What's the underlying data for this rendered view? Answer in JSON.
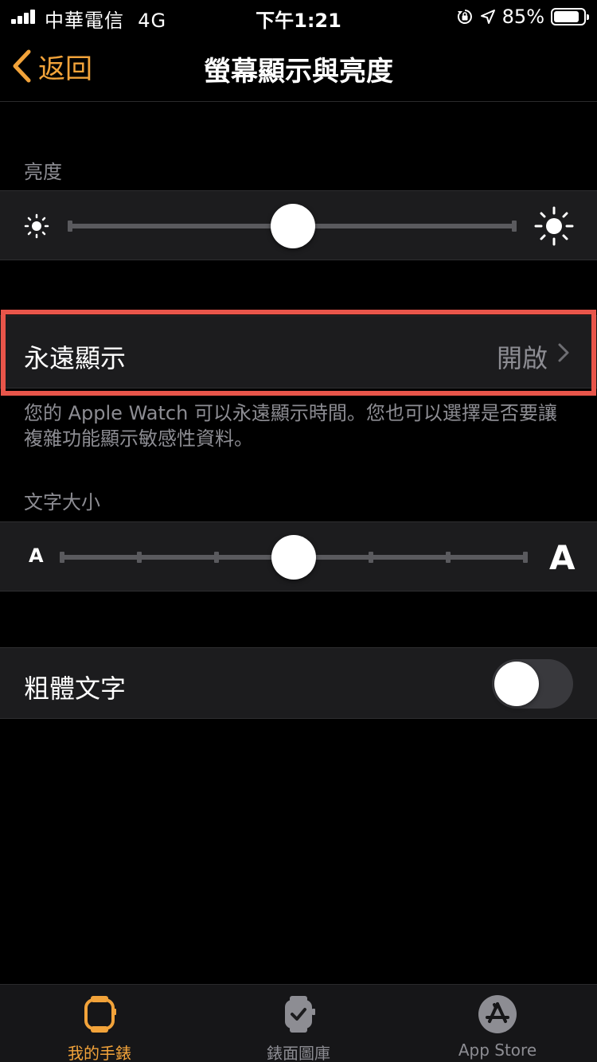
{
  "status_bar": {
    "carrier": "中華電信",
    "network": "4G",
    "time": "下午1:21",
    "battery_percent": "85%",
    "battery_level": 0.85
  },
  "nav": {
    "back_label": "返回",
    "title": "螢幕顯示與亮度"
  },
  "brightness": {
    "header": "亮度",
    "level": 0.5
  },
  "always_on": {
    "label": "永遠顯示",
    "value": "開啟",
    "footnote": "您的 Apple Watch 可以永遠顯示時間。您也可以選擇是否要讓複雜功能顯示敏感性資料。"
  },
  "text_size": {
    "header": "文字大小",
    "small_glyph": "A",
    "large_glyph": "A",
    "steps": 6,
    "current_step": 3
  },
  "bold_text": {
    "label": "粗體文字",
    "enabled": false
  },
  "tab_bar": {
    "tabs": [
      {
        "label": "我的手錶",
        "icon": "watch-icon",
        "active": true
      },
      {
        "label": "錶面圖庫",
        "icon": "watch-face-gallery-icon",
        "active": false
      },
      {
        "label": "App Store",
        "icon": "app-store-icon",
        "active": false
      }
    ]
  },
  "colors": {
    "accent": "#f2a33a",
    "highlight": "#e8554a",
    "cell_background": "#1c1c1e",
    "secondary_text": "#8d8d93"
  }
}
